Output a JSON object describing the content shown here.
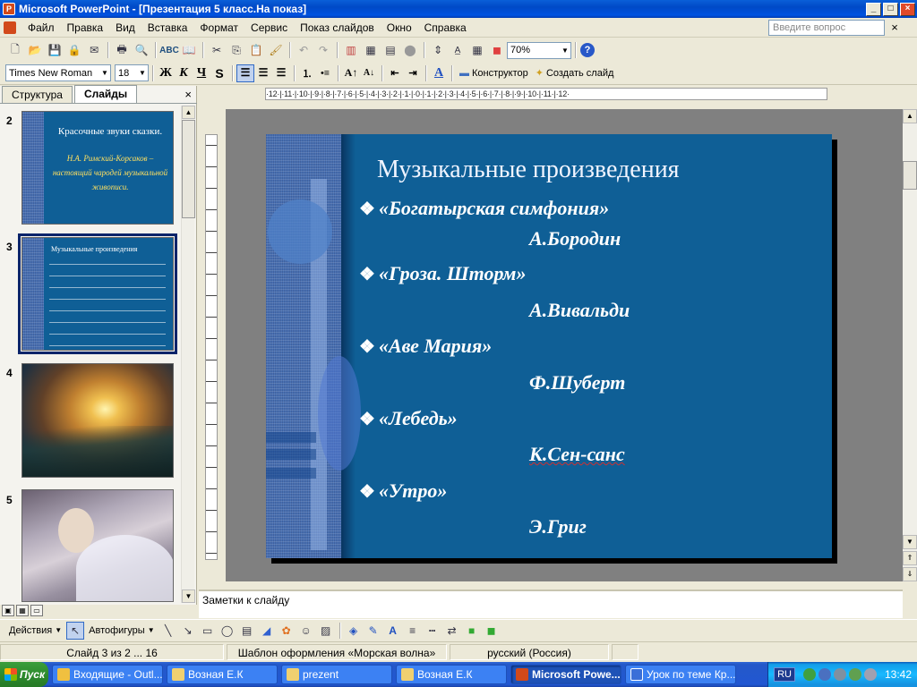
{
  "window": {
    "title": "Microsoft PowerPoint - [Презентация 5 класс.На показ]",
    "app_icon": "P",
    "buttons": {
      "minimize": "_",
      "maximize": "□",
      "close": "×"
    }
  },
  "menu": {
    "items": [
      "Файл",
      "Правка",
      "Вид",
      "Вставка",
      "Формат",
      "Сервис",
      "Показ слайдов",
      "Окно",
      "Справка"
    ],
    "ask_placeholder": "Введите вопрос",
    "close_doc": "×"
  },
  "standard_toolbar": {
    "zoom": "70%",
    "help": "?"
  },
  "format_toolbar": {
    "font": "Times New Roman",
    "size": "18",
    "bold": "Ж",
    "italic": "К",
    "underline": "Ч",
    "shadow": "S",
    "designer_label": "Конструктор",
    "new_slide_label": "Создать слайд"
  },
  "left_panel": {
    "tabs": [
      "Структура",
      "Слайды"
    ],
    "active_tab": "Слайды",
    "close": "×",
    "thumbnails": [
      {
        "number": "2",
        "title": "Красочные звуки сказки.",
        "subtitle": "Н.А. Римский-Корсаков – настоящий чародей музыкальной живописи."
      },
      {
        "number": "3",
        "title": "Музыкальные произведения"
      },
      {
        "number": "4"
      },
      {
        "number": "5"
      }
    ]
  },
  "slide": {
    "title": "Музыкальные произведения",
    "bullet_glyph": "❖",
    "works": [
      {
        "title": "«Богатырская симфония»",
        "composer": "А.Бородин"
      },
      {
        "title": "«Гроза. Шторм»",
        "composer": "А.Вивальди"
      },
      {
        "title": "«Аве Мария»",
        "composer": "Ф.Шуберт"
      },
      {
        "title": "«Лебедь»",
        "composer": "К.Сен-санс"
      },
      {
        "title": "«Утро»",
        "composer": "Э.Григ"
      }
    ]
  },
  "ruler": {
    "horizontal": "·12·|·11·|·10·|·9·|·8·|·7·|·6·|·5·|·4·|·3·|·2·|·1·|·0·|·1·|·2·|·3·|·4·|·5·|·6·|·7·|·8·|·9·|·10·|·11·|·12·"
  },
  "notes": {
    "placeholder": "Заметки к слайду"
  },
  "drawing_toolbar": {
    "actions_label": "Действия",
    "autoshapes_label": "Автофигуры"
  },
  "status_bar": {
    "slide": "Слайд 3 из 2 ... 16",
    "template": "Шаблон оформления «Морская волна»",
    "language": "русский (Россия)"
  },
  "taskbar": {
    "start": "Пуск",
    "tasks": [
      {
        "label": "Входящие - Outl...",
        "color": "#f0c040"
      },
      {
        "label": "Возная Е.К",
        "color": "#f0d070"
      },
      {
        "label": "prezent",
        "color": "#f0d070"
      },
      {
        "label": "Возная Е.К",
        "color": "#f0d070"
      },
      {
        "label": "Microsoft Powe...",
        "color": "#d2491a",
        "active": true
      },
      {
        "label": "Урок по теме Кр...",
        "color": "#3a6fd8"
      }
    ],
    "lang": "RU",
    "time": "13:42"
  },
  "colors": {
    "slide_bg": "#0f5f96",
    "strip": "#4a72b4",
    "title_bar": "#0053e1"
  }
}
